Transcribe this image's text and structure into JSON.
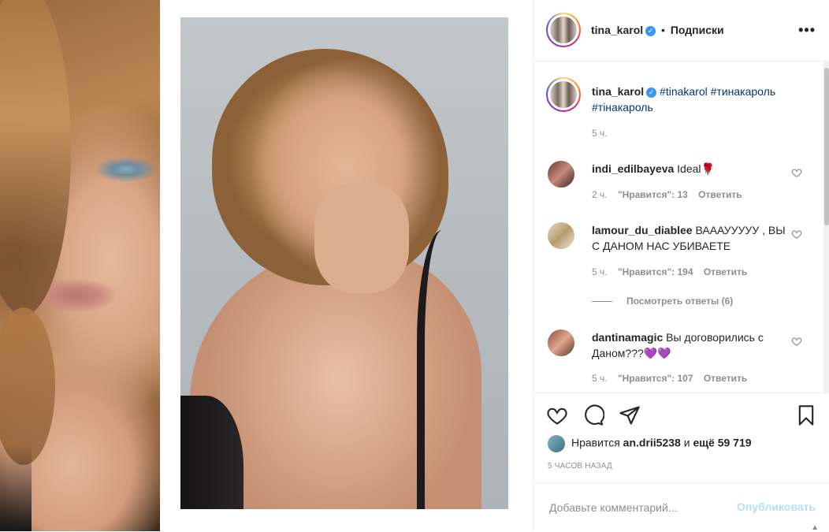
{
  "header": {
    "username": "tina_karol",
    "separator": "•",
    "follow_label": "Подписки",
    "more_icon": "more-horizontal-icon"
  },
  "caption": {
    "username": "tina_karol",
    "text_tag1": "#tinakarol",
    "text_tag2": "#тинакароль",
    "text_tag3": "#тінакароль",
    "time": "5 ч."
  },
  "comments": [
    {
      "username": "indi_edilbayeva",
      "text": "Ideal🌹",
      "time": "2 ч.",
      "likes": "\"Нравится\": 13",
      "reply": "Ответить"
    },
    {
      "username": "lamour_du_diablee",
      "text": "ВАААУУУУУ , ВЫ С ДАНОМ НАС УБИВАЕТЕ",
      "time": "5 ч.",
      "likes": "\"Нравится\": 194",
      "reply": "Ответить",
      "view_replies": "Посмотреть ответы (6)"
    },
    {
      "username": "dantinamagic",
      "text": "Вы договорились с Даном???💜💜",
      "time": "5 ч.",
      "likes": "\"Нравится\": 107",
      "reply": "Ответить"
    }
  ],
  "likes": {
    "prefix": "Нравится",
    "user": "an.drii5238",
    "conj": "и",
    "count": "ещё 59 719"
  },
  "timestamp": "5 ЧАСОВ НАЗАД",
  "comment_box": {
    "placeholder": "Добавьте комментарий...",
    "publish_label": "Опубликовать"
  },
  "colors": {
    "link": "#00376b",
    "muted": "#8e8e8e",
    "verified": "#3897f0",
    "publish_disabled": "#b2dffc"
  }
}
